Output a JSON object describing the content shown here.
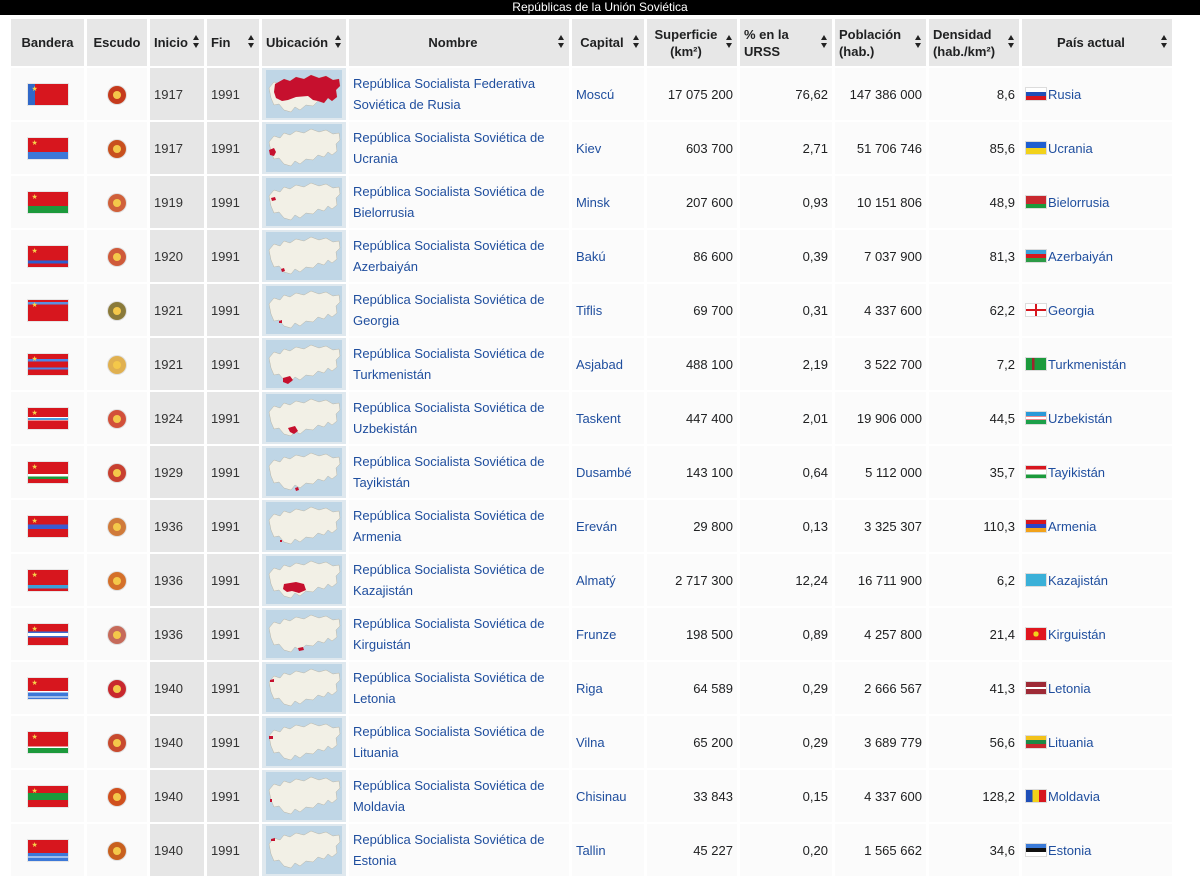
{
  "caption": "Repúblicas de la Unión Soviética",
  "columns": {
    "bandera": "Bandera",
    "escudo": "Escudo",
    "inicio": "Inicio",
    "fin": "Fin",
    "ubicacion": "Ubicación",
    "nombre": "Nombre",
    "capital": "Capital",
    "superficie_1": "Superficie",
    "superficie_2": "(km²)",
    "urss_1": "% en la",
    "urss_2": "URSS",
    "poblacion_1": "Población",
    "poblacion_2": "(hab.)",
    "densidad_1": "Densidad",
    "densidad_2": "(hab./km²)",
    "pais": "País actual"
  },
  "colors": {
    "soviet_red": "#d7161e",
    "link": "#1f4e9e",
    "header_bg": "#e7e7e7",
    "year_bg": "#e6e6e6",
    "map_land": "#f2f0e6",
    "map_highlight": "#c6102e",
    "map_sea": "#bfd6e6"
  },
  "rows": [
    {
      "name_1": "República Socialista Federativa",
      "name_2": "Soviética de Rusia",
      "inicio": "1917",
      "fin": "1991",
      "capital": "Moscú",
      "superficie": "17 075 200",
      "urss": "76,62",
      "poblacion": "147 386 000",
      "densidad": "8,6",
      "pais": "Rusia",
      "flag_icon": "flag-rsfsr-icon",
      "coat_icon": "coat-of-arms-russia-icon",
      "pais_flag_icon": "flag-russia-icon",
      "map_icon": "map-russia-icon"
    },
    {
      "name_1": "República Socialista Soviética de",
      "name_2": "Ucrania",
      "inicio": "1917",
      "fin": "1991",
      "capital": "Kiev",
      "superficie": "603 700",
      "urss": "2,71",
      "poblacion": "51 706 746",
      "densidad": "85,6",
      "pais": "Ucrania",
      "flag_icon": "flag-ukrainian-ssr-icon",
      "coat_icon": "coat-of-arms-ukraine-icon",
      "pais_flag_icon": "flag-ukraine-icon",
      "map_icon": "map-ukraine-icon"
    },
    {
      "name_1": "República Socialista Soviética de",
      "name_2": "Bielorrusia",
      "inicio": "1919",
      "fin": "1991",
      "capital": "Minsk",
      "superficie": "207 600",
      "urss": "0,93",
      "poblacion": "10 151 806",
      "densidad": "48,9",
      "pais": "Bielorrusia",
      "flag_icon": "flag-byelorussian-ssr-icon",
      "coat_icon": "coat-of-arms-belarus-icon",
      "pais_flag_icon": "flag-belarus-icon",
      "map_icon": "map-belarus-icon"
    },
    {
      "name_1": "República Socialista Soviética de",
      "name_2": "Azerbaiyán",
      "inicio": "1920",
      "fin": "1991",
      "capital": "Bakú",
      "superficie": "86 600",
      "urss": "0,39",
      "poblacion": "7 037 900",
      "densidad": "81,3",
      "pais": "Azerbaiyán",
      "flag_icon": "flag-azerbaijan-ssr-icon",
      "coat_icon": "coat-of-arms-azerbaijan-icon",
      "pais_flag_icon": "flag-azerbaijan-icon",
      "map_icon": "map-azerbaijan-icon"
    },
    {
      "name_1": "República Socialista Soviética de",
      "name_2": "Georgia",
      "inicio": "1921",
      "fin": "1991",
      "capital": "Tiflis",
      "superficie": "69 700",
      "urss": "0,31",
      "poblacion": "4 337 600",
      "densidad": "62,2",
      "pais": "Georgia",
      "flag_icon": "flag-georgian-ssr-icon",
      "coat_icon": "coat-of-arms-georgia-icon",
      "pais_flag_icon": "flag-georgia-icon",
      "map_icon": "map-georgia-icon"
    },
    {
      "name_1": "República Socialista Soviética de",
      "name_2": "Turkmenistán",
      "inicio": "1921",
      "fin": "1991",
      "capital": "Asjabad",
      "superficie": "488 100",
      "urss": "2,19",
      "poblacion": "3 522 700",
      "densidad": "7,2",
      "pais": "Turkmenistán",
      "flag_icon": "flag-turkmen-ssr-icon",
      "coat_icon": "coat-of-arms-turkmenistan-icon",
      "pais_flag_icon": "flag-turkmenistan-icon",
      "map_icon": "map-turkmenistan-icon"
    },
    {
      "name_1": "República Socialista Soviética de",
      "name_2": "Uzbekistán",
      "inicio": "1924",
      "fin": "1991",
      "capital": "Taskent",
      "superficie": "447 400",
      "urss": "2,01",
      "poblacion": "19 906 000",
      "densidad": "44,5",
      "pais": "Uzbekistán",
      "flag_icon": "flag-uzbek-ssr-icon",
      "coat_icon": "coat-of-arms-uzbekistan-icon",
      "pais_flag_icon": "flag-uzbekistan-icon",
      "map_icon": "map-uzbekistan-icon"
    },
    {
      "name_1": "República Socialista Soviética de",
      "name_2": "Tayikistán",
      "inicio": "1929",
      "fin": "1991",
      "capital": "Dusambé",
      "superficie": "143 100",
      "urss": "0,64",
      "poblacion": "5 112 000",
      "densidad": "35,7",
      "pais": "Tayikistán",
      "flag_icon": "flag-tajik-ssr-icon",
      "coat_icon": "coat-of-arms-tajikistan-icon",
      "pais_flag_icon": "flag-tajikistan-icon",
      "map_icon": "map-tajikistan-icon"
    },
    {
      "name_1": "República Socialista Soviética de",
      "name_2": "Armenia",
      "inicio": "1936",
      "fin": "1991",
      "capital": "Ereván",
      "superficie": "29 800",
      "urss": "0,13",
      "poblacion": "3 325 307",
      "densidad": "110,3",
      "pais": "Armenia",
      "flag_icon": "flag-armenian-ssr-icon",
      "coat_icon": "coat-of-arms-armenia-icon",
      "pais_flag_icon": "flag-armenia-icon",
      "map_icon": "map-armenia-icon"
    },
    {
      "name_1": "República Socialista Soviética de",
      "name_2": "Kazajistán",
      "inicio": "1936",
      "fin": "1991",
      "capital": "Almatý",
      "superficie": "2 717 300",
      "urss": "12,24",
      "poblacion": "16 711 900",
      "densidad": "6,2",
      "pais": "Kazajistán",
      "flag_icon": "flag-kazakh-ssr-icon",
      "coat_icon": "coat-of-arms-kazakhstan-icon",
      "pais_flag_icon": "flag-kazakhstan-icon",
      "map_icon": "map-kazakhstan-icon"
    },
    {
      "name_1": "República Socialista Soviética de",
      "name_2": "Kirguistán",
      "inicio": "1936",
      "fin": "1991",
      "capital": "Frunze",
      "superficie": "198 500",
      "urss": "0,89",
      "poblacion": "4 257 800",
      "densidad": "21,4",
      "pais": "Kirguistán",
      "flag_icon": "flag-kirghiz-ssr-icon",
      "coat_icon": "coat-of-arms-kyrgyzstan-icon",
      "pais_flag_icon": "flag-kyrgyzstan-icon",
      "map_icon": "map-kyrgyzstan-icon"
    },
    {
      "name_1": "República Socialista Soviética de",
      "name_2": "Letonia",
      "inicio": "1940",
      "fin": "1991",
      "capital": "Riga",
      "superficie": "64 589",
      "urss": "0,29",
      "poblacion": "2 666 567",
      "densidad": "41,3",
      "pais": "Letonia",
      "flag_icon": "flag-latvian-ssr-icon",
      "coat_icon": "coat-of-arms-latvia-icon",
      "pais_flag_icon": "flag-latvia-icon",
      "map_icon": "map-latvia-icon"
    },
    {
      "name_1": "República Socialista Soviética de",
      "name_2": "Lituania",
      "inicio": "1940",
      "fin": "1991",
      "capital": "Vilna",
      "superficie": "65 200",
      "urss": "0,29",
      "poblacion": "3 689 779",
      "densidad": "56,6",
      "pais": "Lituania",
      "flag_icon": "flag-lithuanian-ssr-icon",
      "coat_icon": "coat-of-arms-lithuania-icon",
      "pais_flag_icon": "flag-lithuania-icon",
      "map_icon": "map-lithuania-icon"
    },
    {
      "name_1": "República Socialista Soviética de",
      "name_2": "Moldavia",
      "inicio": "1940",
      "fin": "1991",
      "capital": "Chisinau",
      "superficie": "33 843",
      "urss": "0,15",
      "poblacion": "4 337 600",
      "densidad": "128,2",
      "pais": "Moldavia",
      "flag_icon": "flag-moldavian-ssr-icon",
      "coat_icon": "coat-of-arms-moldova-icon",
      "pais_flag_icon": "flag-moldova-icon",
      "map_icon": "map-moldova-icon"
    },
    {
      "name_1": "República Socialista Soviética de",
      "name_2": "Estonia",
      "inicio": "1940",
      "fin": "1991",
      "capital": "Tallin",
      "superficie": "45 227",
      "urss": "0,20",
      "poblacion": "1 565 662",
      "densidad": "34,6",
      "pais": "Estonia",
      "flag_icon": "flag-estonian-ssr-icon",
      "coat_icon": "coat-of-arms-estonia-icon",
      "pais_flag_icon": "flag-estonia-icon",
      "map_icon": "map-estonia-icon"
    }
  ]
}
